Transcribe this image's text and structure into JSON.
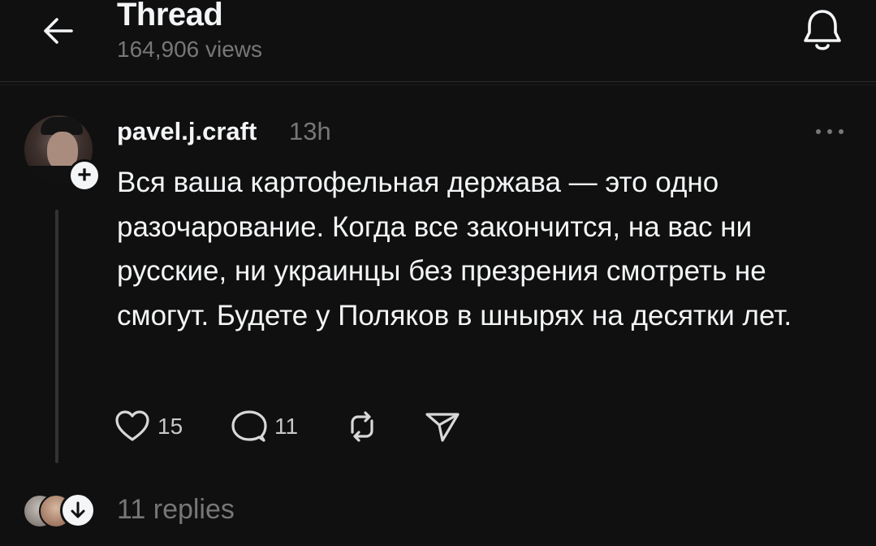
{
  "header": {
    "title": "Thread",
    "views": "164,906 views",
    "back_icon": "arrow-left-icon",
    "bell_icon": "bell-icon"
  },
  "post": {
    "username": "pavel.j.craft",
    "timestamp": "13h",
    "text": "Вся ваша картофельная держава — это одно разочарование. Когда все закончится, на вас ни русские, ни украинцы без презрения смотреть не смогут. Будете у Поляков в шнырях на десятки лет.",
    "follow_symbol": "+",
    "more_icon": "more-horizontal-icon",
    "likes": "15",
    "comments": "11"
  },
  "replies": {
    "label": "11 replies"
  },
  "colors": {
    "background": "#101010",
    "text_primary": "#f3f5f7",
    "text_secondary": "#777777"
  }
}
